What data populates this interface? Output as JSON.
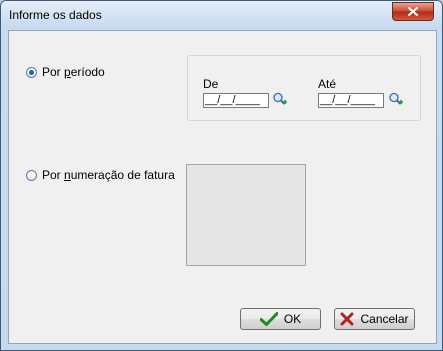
{
  "window": {
    "title": "Informe os dados",
    "close_icon": "close-x-icon"
  },
  "options": {
    "period": {
      "label_before": "Por ",
      "label_accel": "p",
      "label_after": "eríodo",
      "selected": true
    },
    "invoice": {
      "label_before": "Por ",
      "label_accel": "n",
      "label_after": "umeração de fatura",
      "selected": false
    }
  },
  "period_fields": {
    "from_label": "De",
    "from_value": "__/__/____",
    "to_label": "Até",
    "to_value": "__/__/____",
    "lookup_icon": "search-calendar-icon"
  },
  "buttons": {
    "ok_label": "OK",
    "cancel_label": "Cancelar",
    "ok_icon": "check-icon",
    "cancel_icon": "x-mark-icon"
  },
  "colors": {
    "ok_check": "#1f8a1f",
    "cancel_x": "#b0221b"
  }
}
